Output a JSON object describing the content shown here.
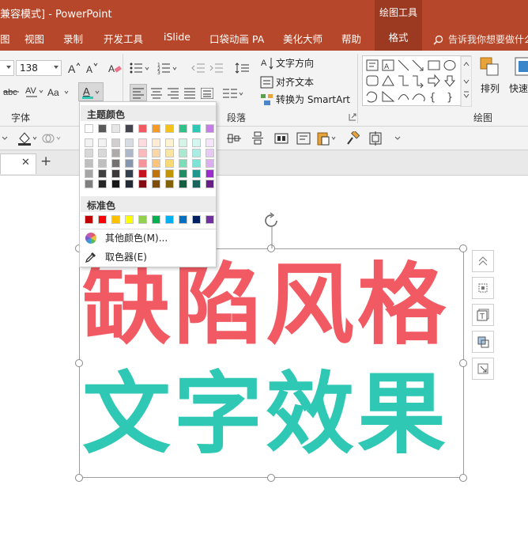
{
  "window": {
    "title": "兼容模式] - PowerPoint",
    "contextual_group": "绘图工具"
  },
  "ribbon_tabs": [
    {
      "label": "图",
      "active": false
    },
    {
      "label": "视图",
      "active": false
    },
    {
      "label": "录制",
      "active": false
    },
    {
      "label": "开发工具",
      "active": false
    },
    {
      "label": "iSlide",
      "active": false
    },
    {
      "label": "口袋动画 PA",
      "active": false
    },
    {
      "label": "美化大师",
      "active": false
    },
    {
      "label": "帮助",
      "active": false
    },
    {
      "label": "格式",
      "active": true
    }
  ],
  "tell_me": "告诉我你想要做什么",
  "font": {
    "size_value": "138",
    "group_label": "字体",
    "text_direction": "文字方向",
    "align_text": "对齐文本",
    "convert_smartart": "转换为 SmartArt",
    "paragraph_label": "段落",
    "arrange_label": "排列",
    "quick_styles_label": "快速",
    "drawing_label": "绘图"
  },
  "colors": {
    "accent_red": "#b7472a",
    "text_red": "#f25a63",
    "text_teal": "#2ec8b4"
  },
  "slide": {
    "line1": "缺陷风格",
    "line2": "文字效果"
  },
  "color_dropdown": {
    "theme_colors_title": "主题颜色",
    "standard_colors_title": "标准色",
    "more_colors": "其他颜色(M)...",
    "eyedropper": "取色器(E)",
    "theme_columns": [
      [
        "#ffffff",
        "#f2f2f2",
        "#d8d8d8",
        "#bfbfbf",
        "#a5a5a5",
        "#7f7f7f"
      ],
      [
        "#595959",
        "#f2f2f2",
        "#d8d8d8",
        "#bfbfbf",
        "#404040",
        "#262626"
      ],
      [
        "#e7e6e6",
        "#d0cece",
        "#aeaaaa",
        "#757070",
        "#3a3838",
        "#171616"
      ],
      [
        "#44444f",
        "#d6dce4",
        "#adb9ca",
        "#8496b0",
        "#323f4f",
        "#222a35"
      ],
      [
        "#ef5a63",
        "#fcdcde",
        "#f9b9bd",
        "#f5959b",
        "#c3141f",
        "#820d15"
      ],
      [
        "#f59a23",
        "#fdebd3",
        "#fbd7a7",
        "#f9c37b",
        "#c0730b",
        "#804d07"
      ],
      [
        "#f5c21b",
        "#fdf2d1",
        "#fbe5a3",
        "#f9d975",
        "#c29509",
        "#816306"
      ],
      [
        "#2dc389",
        "#d3f4e7",
        "#a8e9d0",
        "#7cdeb8",
        "#1e8f63",
        "#145f42"
      ],
      [
        "#2ec8b4",
        "#d4f6f1",
        "#a9ece3",
        "#7de3d5",
        "#21968a",
        "#16645c"
      ],
      [
        "#c77ce8",
        "#f3e4fa",
        "#e8c9f5",
        "#dcaef1",
        "#9c2dcc",
        "#681e88"
      ]
    ],
    "standard_colors": [
      "#c00000",
      "#ff0000",
      "#ffc000",
      "#ffff00",
      "#92d050",
      "#00b050",
      "#00b0f0",
      "#0070c0",
      "#002060",
      "#7030a0"
    ]
  }
}
